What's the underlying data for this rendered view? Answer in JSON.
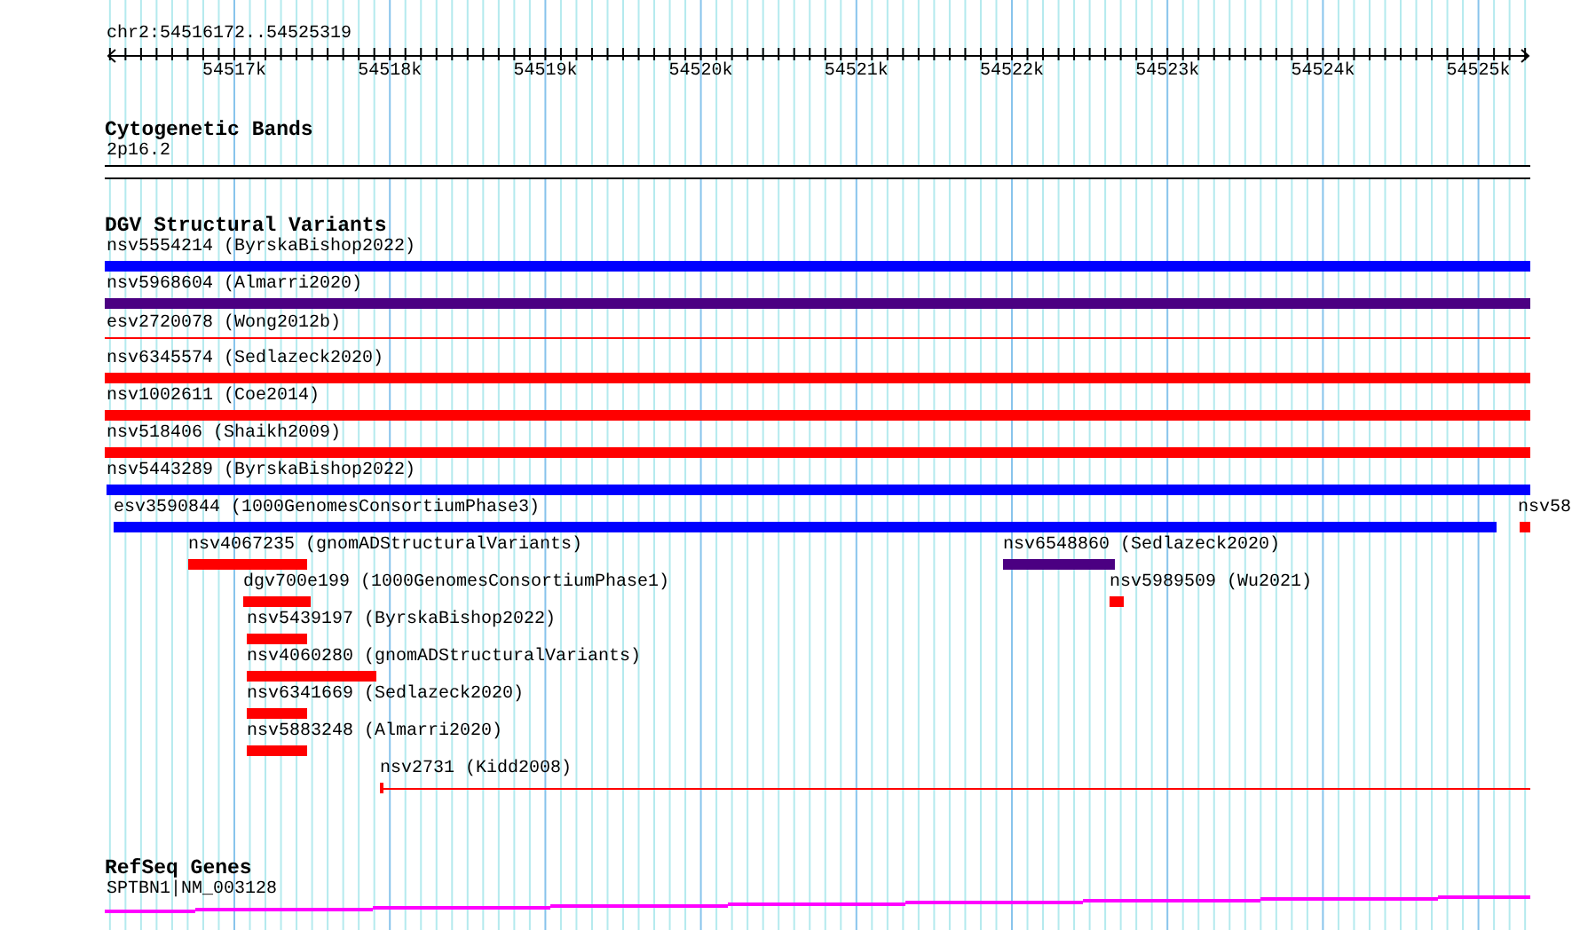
{
  "ruler": {
    "location": "chr2:54516172..54525319",
    "ticks": [
      "54517k",
      "54518k",
      "54519k",
      "54520k",
      "54521k",
      "54522k",
      "54523k",
      "54524k",
      "54525k"
    ]
  },
  "tracks": [
    {
      "kind": "bands",
      "title": "Cytogenetic Bands",
      "features": [
        {
          "label": "2p16.2"
        }
      ]
    },
    {
      "kind": "variants",
      "title": "DGV Structural Variants",
      "features": [
        {
          "label": "nsv5554214 (ByrskaBishop2022)",
          "color": "#0000ff",
          "kind": "bar"
        },
        {
          "label": "nsv5968604 (Almarri2020)",
          "color": "#4b0082",
          "kind": "bar"
        },
        {
          "label": "esv2720078 (Wong2012b)",
          "color": "#ff0000",
          "kind": "line"
        },
        {
          "label": "nsv6345574 (Sedlazeck2020)",
          "color": "#ff0000",
          "kind": "bar"
        },
        {
          "label": "nsv1002611 (Coe2014)",
          "color": "#ff0000",
          "kind": "bar"
        },
        {
          "label": "nsv518406 (Shaikh2009)",
          "color": "#ff0000",
          "kind": "bar"
        },
        {
          "label": "nsv5443289 (ByrskaBishop2022)",
          "color": "#0000ff",
          "kind": "bar"
        },
        {
          "label": "esv3590844 (1000GenomesConsortiumPhase3)",
          "color": "#0000ff",
          "kind": "bar"
        },
        {
          "label": "nsv58",
          "color": "#ff0000",
          "kind": "bar"
        },
        {
          "label": "nsv4067235 (gnomADStructuralVariants)",
          "color": "#ff0000",
          "kind": "bar"
        },
        {
          "label": "nsv6548860 (Sedlazeck2020)",
          "color": "#4b0082",
          "kind": "bar"
        },
        {
          "label": "dgv700e199 (1000GenomesConsortiumPhase1)",
          "color": "#ff0000",
          "kind": "bar"
        },
        {
          "label": "nsv5989509 (Wu2021)",
          "color": "#ff0000",
          "kind": "bar"
        },
        {
          "label": "nsv5439197 (ByrskaBishop2022)",
          "color": "#ff0000",
          "kind": "bar"
        },
        {
          "label": "nsv4060280 (gnomADStructuralVariants)",
          "color": "#ff0000",
          "kind": "bar"
        },
        {
          "label": "nsv6341669 (Sedlazeck2020)",
          "color": "#ff0000",
          "kind": "bar"
        },
        {
          "label": "nsv5883248 (Almarri2020)",
          "color": "#ff0000",
          "kind": "bar"
        },
        {
          "label": "nsv2731 (Kidd2008)",
          "color": "#ff0000",
          "kind": "span"
        }
      ]
    },
    {
      "kind": "genes",
      "title": "RefSeq Genes",
      "features": [
        {
          "label": "SPTBN1|NM_003128"
        }
      ]
    }
  ]
}
